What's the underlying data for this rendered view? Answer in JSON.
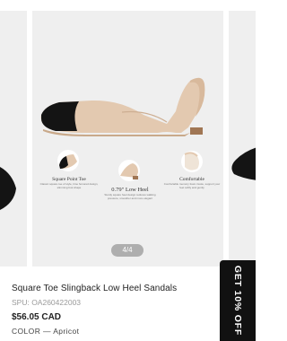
{
  "gallery": {
    "counter": "4/4",
    "features": [
      {
        "title": "Square Point Toe",
        "desc": "Classic square toe of style, time honored design, slimming foot shape"
      },
      {
        "title": "0.79\" Low Heel",
        "desc": "Sturdy square heel design reduces walking pressure, smoother and more elegant"
      },
      {
        "title": "Comfortable",
        "desc": "Comfortable memory foam insole, support your feet softly and gently"
      }
    ],
    "colors": {
      "background": "#efefef",
      "upper": "#e3c9b0",
      "toe_cap": "#141414"
    }
  },
  "product": {
    "title": "Square Toe Slingback Low Heel Sandals",
    "sku": "SPU: OA260422003",
    "price": "$56.05 CAD",
    "color_label": "COLOR",
    "color_value": "— Apricot"
  },
  "promo": {
    "label": "GET 10% OFF",
    "background": "#111111"
  }
}
